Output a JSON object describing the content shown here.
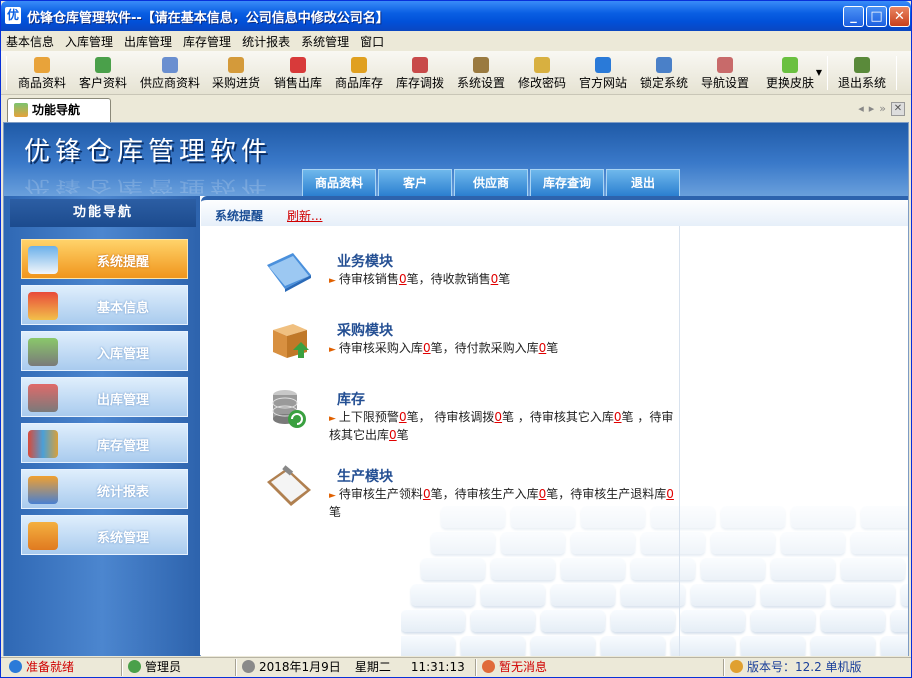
{
  "window": {
    "icon_text": "优",
    "title": "优锋仓库管理软件--【请在基本信息，公司信息中修改公司名】"
  },
  "menu": [
    "基本信息",
    "入库管理",
    "出库管理",
    "库存管理",
    "统计报表",
    "系统管理",
    "窗口"
  ],
  "toolbar": {
    "buttons": [
      {
        "label": "商品资料",
        "icon": "goods-icon",
        "color": "#e8a33a"
      },
      {
        "label": "客户资料",
        "icon": "customer-icon",
        "color": "#4aa04a"
      },
      {
        "label": "供应商资料",
        "icon": "supplier-icon",
        "color": "#6a8fd0"
      },
      {
        "label": "采购进货",
        "icon": "purchase-icon",
        "color": "#d49a3a"
      },
      {
        "label": "销售出库",
        "icon": "sales-icon",
        "color": "#d83a3a"
      },
      {
        "label": "商品库存",
        "icon": "stock-icon",
        "color": "#e0a020"
      },
      {
        "label": "库存调拨",
        "icon": "transfer-icon",
        "color": "#c84a4a"
      },
      {
        "label": "系统设置",
        "icon": "settings-icon",
        "color": "#9a7a40"
      },
      {
        "label": "修改密码",
        "icon": "password-icon",
        "color": "#d8b040"
      },
      {
        "label": "官方网站",
        "icon": "ie-icon",
        "color": "#2a7ad8"
      },
      {
        "label": "锁定系统",
        "icon": "lock-icon",
        "color": "#4a80c8"
      },
      {
        "label": "导航设置",
        "icon": "nav-settings-icon",
        "color": "#c86a6a"
      },
      {
        "label": "更换皮肤",
        "icon": "skin-icon",
        "color": "#6ac040"
      },
      {
        "label": "退出系统",
        "icon": "exit-icon",
        "color": "#5a8a3a"
      }
    ]
  },
  "tab": {
    "label": "功能导航"
  },
  "banner": {
    "title": "优锋仓库管理软件",
    "tabs": [
      "商品资料",
      "客户",
      "供应商",
      "库存查询",
      "退出"
    ]
  },
  "left_nav": {
    "heading": "功能导航",
    "items": [
      {
        "label": "系统提醒",
        "icon": "reminder-icon",
        "active": true
      },
      {
        "label": "基本信息",
        "icon": "basic-info-icon",
        "active": false
      },
      {
        "label": "入库管理",
        "icon": "inbound-cart-icon",
        "active": false
      },
      {
        "label": "出库管理",
        "icon": "outbound-cart-icon",
        "active": false
      },
      {
        "label": "库存管理",
        "icon": "inventory-houses-icon",
        "active": false
      },
      {
        "label": "统计报表",
        "icon": "report-icon",
        "active": false
      },
      {
        "label": "系统管理",
        "icon": "system-icon",
        "active": false
      }
    ]
  },
  "content": {
    "header_label": "系统提醒",
    "refresh_label": "刷新...",
    "modules": [
      {
        "title": "业务模块",
        "icon": "book-icon",
        "parts": [
          "待审核销售",
          "0",
          "笔，待收款销售",
          "0",
          "笔"
        ]
      },
      {
        "title": "采购模块",
        "icon": "package-icon",
        "parts": [
          "待审核采购入库",
          "0",
          "笔，待付款采购入库",
          "0",
          "笔"
        ]
      },
      {
        "title": "库存",
        "icon": "database-icon",
        "parts": [
          "上下限预警",
          "0",
          "笔， 待审核调拨",
          "0",
          "笔 ，待审核其它入库",
          "0",
          "笔 ，待审核其它出库",
          "0",
          "笔"
        ]
      },
      {
        "title": "生产模块",
        "icon": "clipboard-icon",
        "parts": [
          "待审核生产领料",
          "0",
          "笔，待审核生产入库",
          "0",
          "笔，待审核生产退料库",
          "0",
          "笔"
        ]
      }
    ]
  },
  "status": {
    "ready": "准备就绪",
    "user": "管理员",
    "date": "2018年1月9日",
    "weekday": "星期二",
    "time": "11:31:13",
    "messages": "暂无消息",
    "version": "版本号：12.2 单机版"
  }
}
